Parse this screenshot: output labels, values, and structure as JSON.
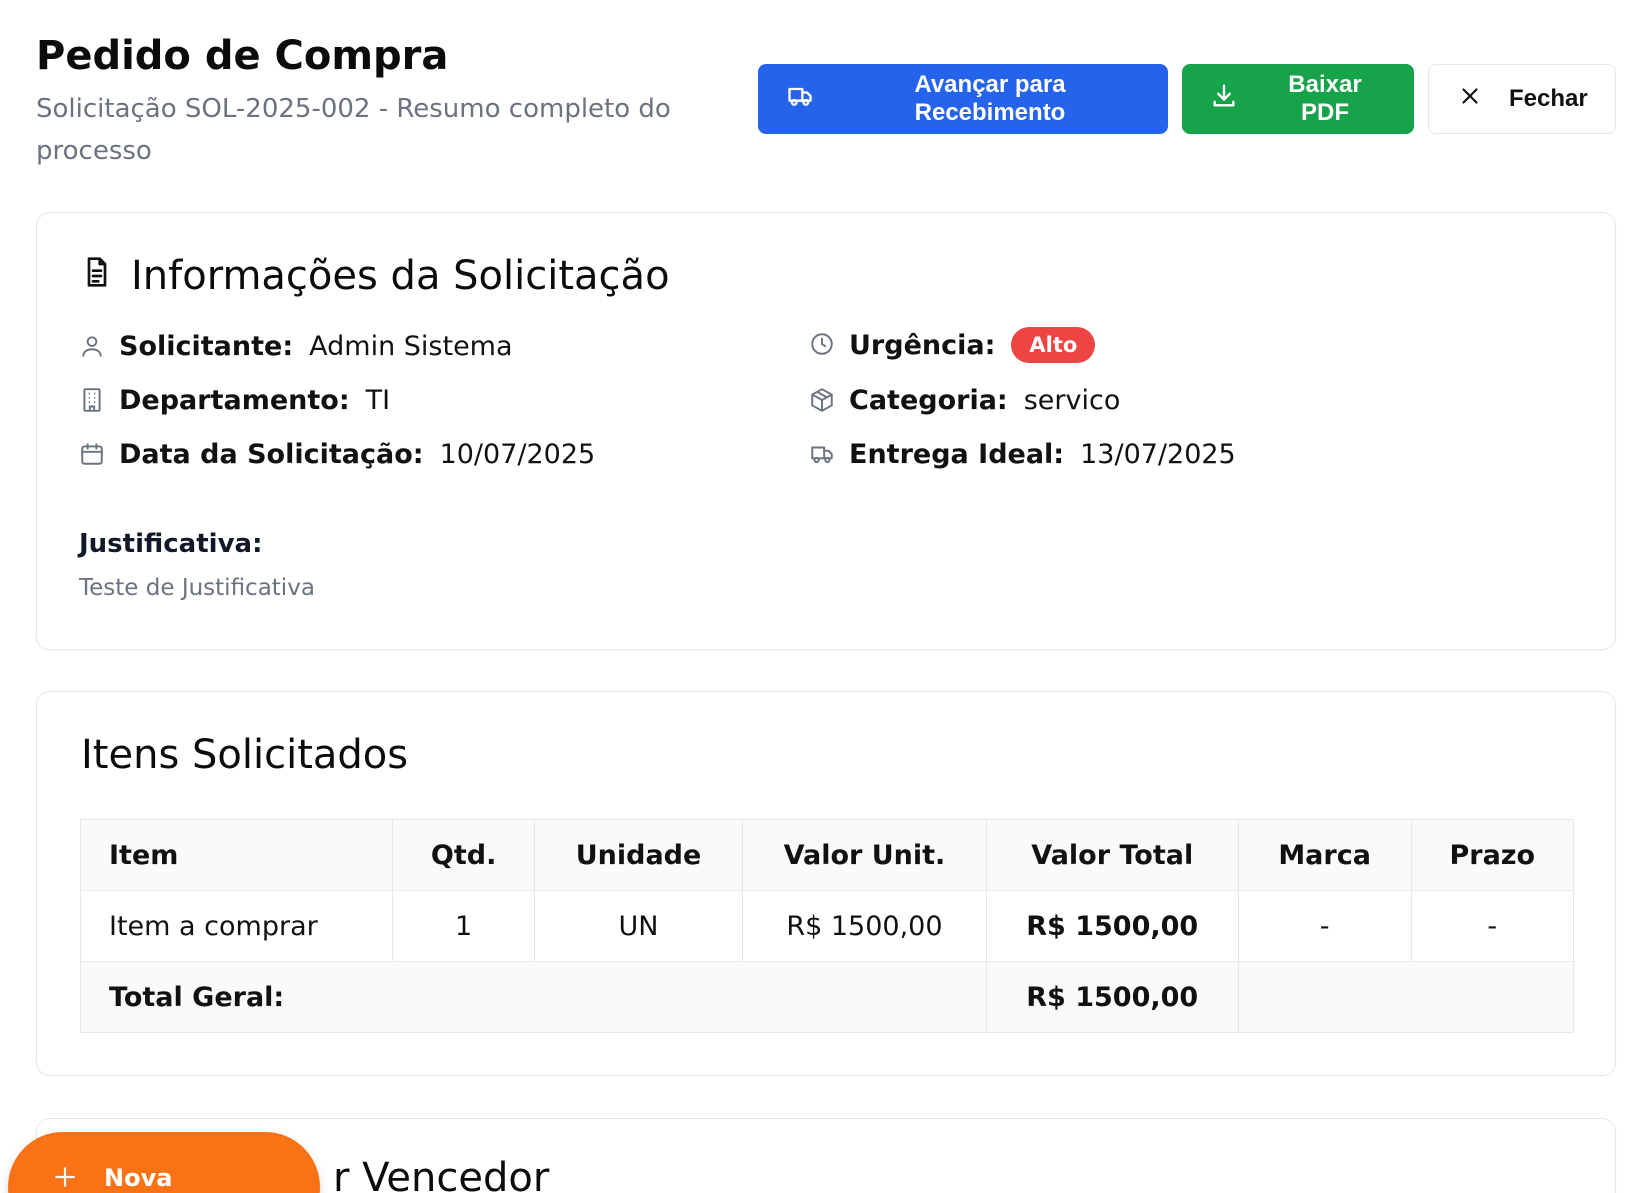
{
  "header": {
    "title": "Pedido de Compra",
    "subtitle": "Solicitação SOL-2025-002 - Resumo completo do processo",
    "actions": {
      "advance_label": "Avançar para Recebimento",
      "pdf_label": "Baixar PDF",
      "close_label": "Fechar"
    }
  },
  "info": {
    "title": "Informações da Solicitação",
    "requester_label": "Solicitante:",
    "requester_value": "Admin Sistema",
    "department_label": "Departamento:",
    "department_value": "TI",
    "date_label": "Data da Solicitação:",
    "date_value": "10/07/2025",
    "urgency_label": "Urgência:",
    "urgency_value": "Alto",
    "category_label": "Categoria:",
    "category_value": "servico",
    "delivery_label": "Entrega Ideal:",
    "delivery_value": "13/07/2025",
    "justification_label": "Justificativa:",
    "justification_value": "Teste de Justificativa"
  },
  "items": {
    "title": "Itens Solicitados",
    "columns": [
      "Item",
      "Qtd.",
      "Unidade",
      "Valor Unit.",
      "Valor Total",
      "Marca",
      "Prazo"
    ],
    "rows": [
      {
        "item": "Item a comprar",
        "qty": "1",
        "unit": "UN",
        "unit_value": "R$ 1500,00",
        "total_value": "R$ 1500,00",
        "brand": "-",
        "deadline": "-"
      }
    ],
    "total_label": "Total Geral:",
    "total_value": "R$ 1500,00"
  },
  "winner": {
    "title_partial": "r Vencedor"
  },
  "fab": {
    "label": "Nova Solicitação"
  },
  "colors": {
    "primary_blue": "#2563eb",
    "success_green": "#16a34a",
    "urgency_red": "#ef4444",
    "fab_orange": "#f97316"
  }
}
